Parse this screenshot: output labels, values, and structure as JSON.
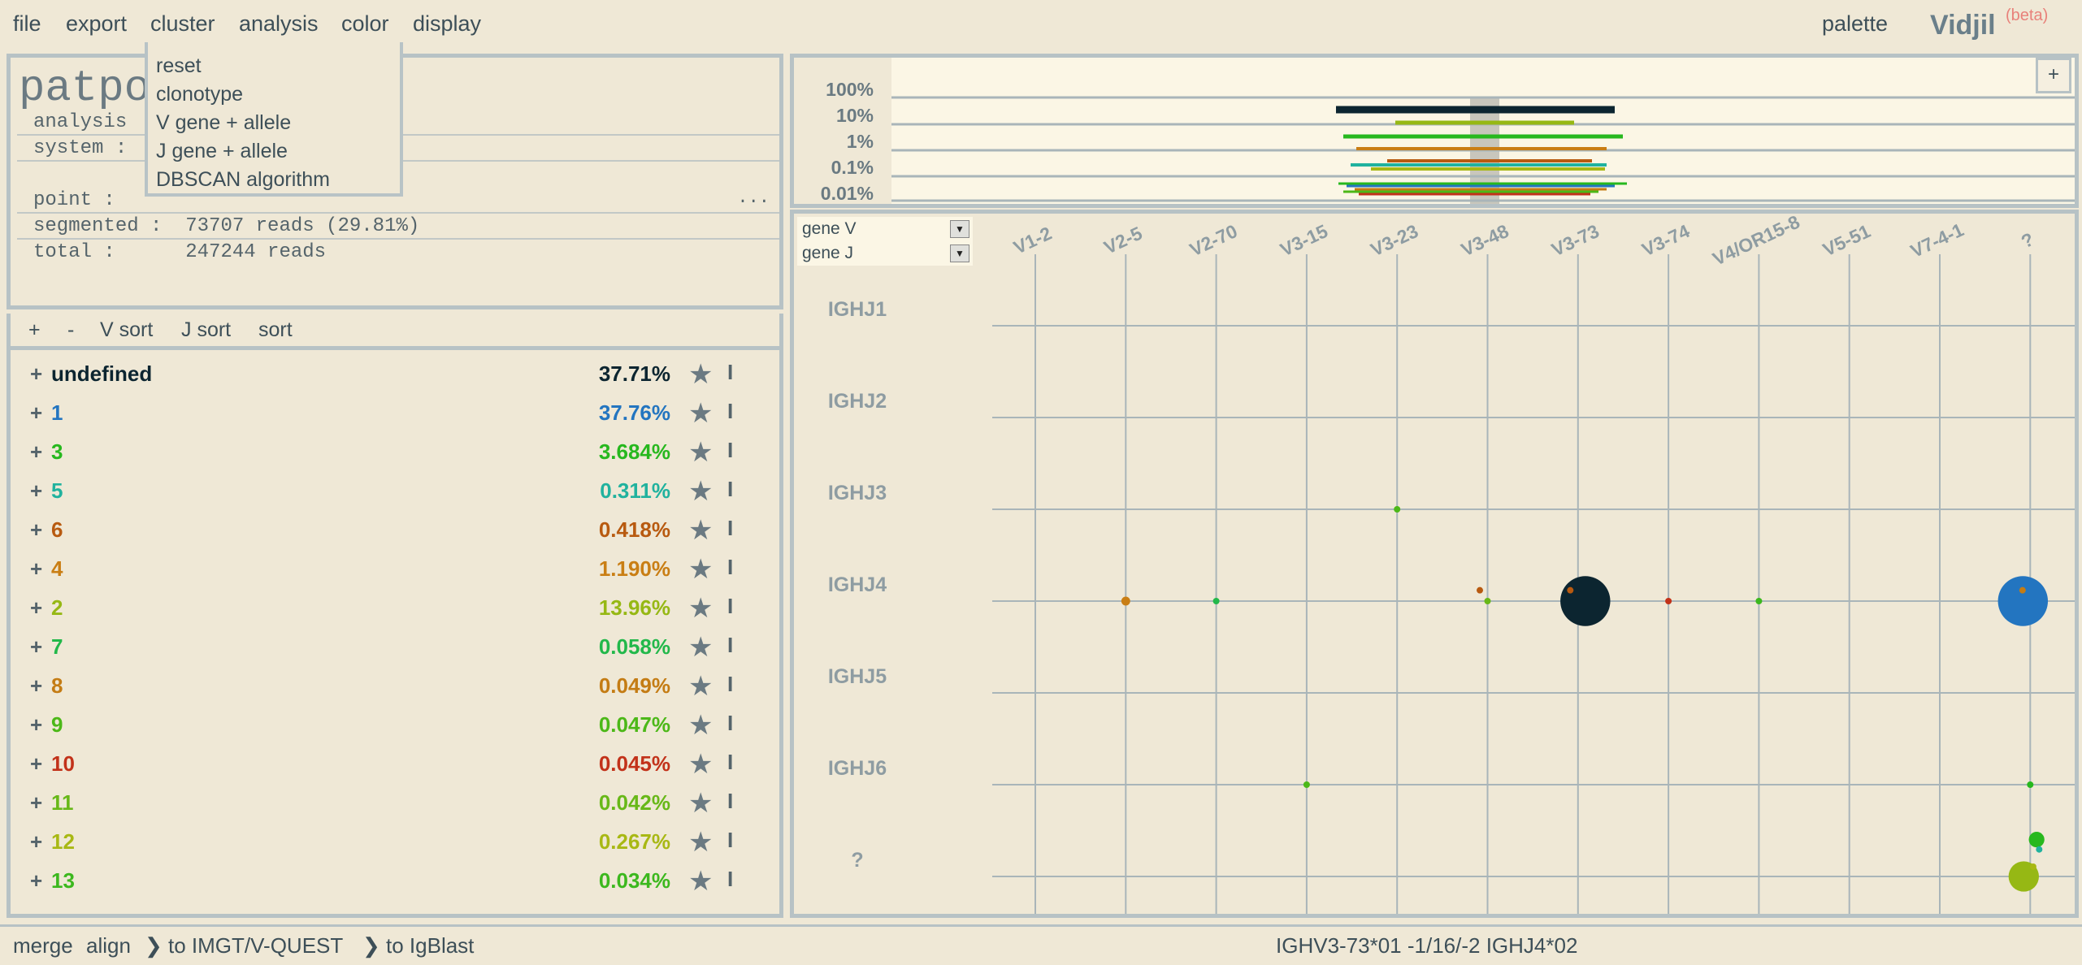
{
  "menu": {
    "items": [
      "file",
      "export",
      "cluster",
      "analysis",
      "color",
      "display"
    ],
    "palette": "palette",
    "logo": "Vidjil",
    "beta": "(beta)"
  },
  "cluster_menu": {
    "items": [
      "reset",
      "clonotype",
      "V gene + allele",
      "J gene + allele",
      "DBSCAN algorithm"
    ]
  },
  "info": {
    "sample_name": "patpo",
    "analysis_label": "analysis",
    "system_label": "system :",
    "point_label": "point :",
    "segmented": "segmented :  73707 reads (29.81%)",
    "total": "total :      247244 reads",
    "more": "..."
  },
  "sort_bar": {
    "items": [
      "+",
      "-",
      "V sort",
      "J sort",
      "sort"
    ]
  },
  "clones": [
    {
      "name": "undefined",
      "size": "37.71%",
      "color": "#0c2530"
    },
    {
      "name": "1",
      "size": "37.76%",
      "color": "#2375c0"
    },
    {
      "name": "3",
      "size": "3.684%",
      "color": "#27b81e"
    },
    {
      "name": "5",
      "size": "0.311%",
      "color": "#20b29e"
    },
    {
      "name": "6",
      "size": "0.418%",
      "color": "#b85a10"
    },
    {
      "name": "4",
      "size": "1.190%",
      "color": "#c97e14"
    },
    {
      "name": "2",
      "size": "13.96%",
      "color": "#96b814"
    },
    {
      "name": "7",
      "size": "0.058%",
      "color": "#22b84a"
    },
    {
      "name": "8",
      "size": "0.049%",
      "color": "#c47c14"
    },
    {
      "name": "9",
      "size": "0.047%",
      "color": "#4cb818"
    },
    {
      "name": "10",
      "size": "0.045%",
      "color": "#c2321a"
    },
    {
      "name": "11",
      "size": "0.042%",
      "color": "#68b818"
    },
    {
      "name": "12",
      "size": "0.267%",
      "color": "#a8b814"
    },
    {
      "name": "13",
      "size": "0.034%",
      "color": "#3cb81e"
    }
  ],
  "clone_controls": {
    "plus": "+",
    "star": "★",
    "info": "I"
  },
  "timeline": {
    "scale_labels": [
      "100%",
      "10%",
      "1%",
      "0.1%",
      "0.01%"
    ],
    "expand": "+"
  },
  "scatter": {
    "x_select": "gene V",
    "y_select": "gene J",
    "x_labels": [
      "V1-2",
      "V2-5",
      "V2-70",
      "V3-15",
      "V3-23",
      "V3-48",
      "V3-73",
      "V3-74",
      "V4/OR15-8",
      "V5-51",
      "V7-4-1",
      "?"
    ],
    "y_labels": [
      "IGHJ1",
      "IGHJ2",
      "IGHJ3",
      "IGHJ4",
      "IGHJ5",
      "IGHJ6",
      "?"
    ]
  },
  "chart_data": {
    "type": "scatter",
    "x_categories": [
      "V1-2",
      "V2-5",
      "V2-70",
      "V3-15",
      "V3-23",
      "V3-48",
      "V3-73",
      "V3-74",
      "V4/OR15-8",
      "V5-51",
      "V7-4-1",
      "?"
    ],
    "y_categories": [
      "IGHJ1",
      "IGHJ2",
      "IGHJ3",
      "IGHJ4",
      "IGHJ5",
      "IGHJ6",
      "?"
    ],
    "points": [
      {
        "clone": "undefined",
        "x": "V3-73",
        "y": "IGHJ4",
        "size": 37.71,
        "color": "#0c2530"
      },
      {
        "clone": "1",
        "x": "?",
        "y": "IGHJ4",
        "size": 37.76,
        "color": "#2375c0"
      },
      {
        "clone": "2",
        "x": "?",
        "y": "?",
        "size": 13.96,
        "color": "#96b814"
      },
      {
        "clone": "3",
        "x": "?",
        "y": "?",
        "size": 3.684,
        "color": "#27b81e"
      },
      {
        "clone": "4",
        "x": "V2-5",
        "y": "IGHJ4",
        "size": 1.19,
        "color": "#c97e14"
      },
      {
        "clone": "6",
        "x": "V3-73",
        "y": "IGHJ4",
        "size": 0.418,
        "color": "#b85a10"
      },
      {
        "clone": "5",
        "x": "?",
        "y": "?",
        "size": 0.311,
        "color": "#20b29e"
      },
      {
        "clone": "12",
        "x": "?",
        "y": "?",
        "size": 0.267,
        "color": "#a8b814"
      },
      {
        "clone": "7",
        "x": "V2-70",
        "y": "IGHJ4",
        "size": 0.058,
        "color": "#22b84a"
      },
      {
        "clone": "8",
        "x": "?",
        "y": "IGHJ4",
        "size": 0.049,
        "color": "#c47c14"
      },
      {
        "clone": "9",
        "x": "V3-23",
        "y": "IGHJ3",
        "size": 0.047,
        "color": "#4cb818"
      },
      {
        "clone": "10",
        "x": "V3-74",
        "y": "IGHJ4",
        "size": 0.045,
        "color": "#c2321a"
      },
      {
        "clone": "11",
        "x": "V3-48",
        "y": "IGHJ4",
        "size": 0.042,
        "color": "#68b818"
      },
      {
        "clone": "13",
        "x": "V4/OR15-8",
        "y": "IGHJ4",
        "size": 0.034,
        "color": "#3cb81e"
      },
      {
        "clone": "",
        "x": "V3-15",
        "y": "IGHJ6",
        "size": 0.03,
        "color": "#4cb818"
      },
      {
        "clone": "",
        "x": "?",
        "y": "IGHJ6",
        "size": 0.03,
        "color": "#27b81e"
      },
      {
        "clone": "",
        "x": "V3-48",
        "y": "IGHJ4",
        "size": 0.03,
        "color": "#b85a10"
      }
    ]
  },
  "status": {
    "items": [
      "merge",
      "align",
      "❯ to IMGT/V-QUEST",
      "❯ to IgBlast"
    ],
    "text": "IGHV3-73*01 -1/16/-2 IGHJ4*02"
  }
}
